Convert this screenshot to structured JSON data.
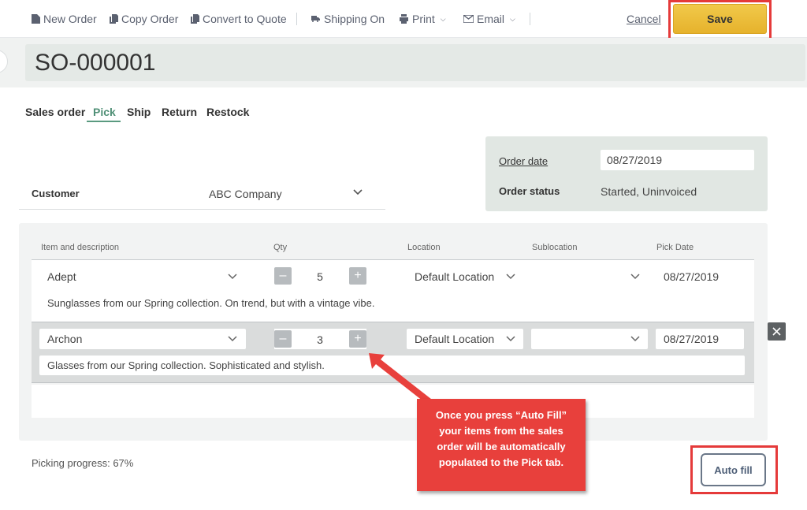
{
  "toolbar": {
    "new_order": "New Order",
    "copy_order": "Copy Order",
    "convert_to_quote": "Convert to Quote",
    "shipping_on": "Shipping On",
    "print": "Print",
    "email": "Email",
    "cancel": "Cancel",
    "save": "Save"
  },
  "order_number": "SO-000001",
  "tabs": [
    {
      "label": "Sales order"
    },
    {
      "label": "Pick"
    },
    {
      "label": "Ship"
    },
    {
      "label": "Return"
    },
    {
      "label": "Restock"
    }
  ],
  "active_tab": "Pick",
  "customer": {
    "label": "Customer",
    "value": "ABC Company"
  },
  "order_info": {
    "date_label": "Order date",
    "date_value": "08/27/2019",
    "status_label": "Order status",
    "status_value": "Started, Uninvoiced"
  },
  "columns": [
    "Item and description",
    "Qty",
    "Location",
    "Sublocation",
    "Pick Date"
  ],
  "items": [
    {
      "name": "Adept",
      "qty": "5",
      "location": "Default Location",
      "sublocation": "",
      "pick_date": "08/27/2019",
      "description": "Sunglasses from our Spring collection. On trend, but with a vintage vibe."
    },
    {
      "name": "Archon",
      "qty": "3",
      "location": "Default Location",
      "sublocation": "",
      "pick_date": "08/27/2019",
      "description": "Glasses from our Spring collection. Sophisticated and stylish."
    }
  ],
  "picking_progress": "Picking progress: 67%",
  "auto_fill": "Auto fill",
  "callout_text": "Once you press “Auto Fill” your items from the sales order will be automatically populated to the Pick tab.",
  "colors": {
    "accent_green": "#4f8f76",
    "save_yellow": "#e6b22c",
    "highlight_red": "#e53a3a",
    "callout_red": "#e8403c"
  }
}
